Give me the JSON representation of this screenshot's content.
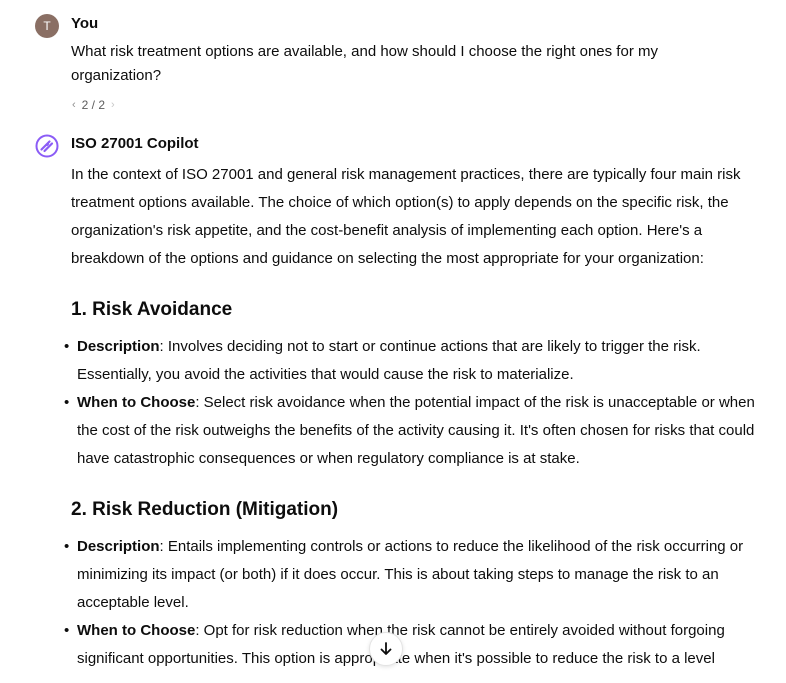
{
  "user_message": {
    "avatar_letter": "T",
    "author": "You",
    "text": "What risk treatment options are available, and how should I choose the right ones for my organization?",
    "pager": {
      "prev_icon": "chevron-left-icon",
      "label": "2 / 2",
      "next_icon": "chevron-right-icon"
    }
  },
  "assistant_message": {
    "author": "ISO 27001 Copilot",
    "avatar_icon": "copilot-logo-icon",
    "avatar_color": "#8b5cf6",
    "intro": "In the context of ISO 27001 and general risk management practices, there are typically four main risk treatment options available. The choice of which option(s) to apply depends on the specific risk, the organization's risk appetite, and the cost-benefit analysis of implementing each option. Here's a breakdown of the options and guidance on selecting the most appropriate for your organization:",
    "sections": [
      {
        "heading": "1. Risk Avoidance",
        "items": [
          {
            "label": "Description",
            "text": ": Involves deciding not to start or continue actions that are likely to trigger the risk. Essentially, you avoid the activities that would cause the risk to materialize."
          },
          {
            "label": "When to Choose",
            "text": ": Select risk avoidance when the potential impact of the risk is unacceptable or when the cost of the risk outweighs the benefits of the activity causing it. It's often chosen for risks that could have catastrophic consequences or when regulatory compliance is at stake."
          }
        ]
      },
      {
        "heading": "2. Risk Reduction (Mitigation)",
        "items": [
          {
            "label": "Description",
            "text": ": Entails implementing controls or actions to reduce the likelihood of the risk occurring or minimizing its impact (or both) if it does occur. This is about taking steps to manage the risk to an acceptable level."
          },
          {
            "label": "When to Choose",
            "text": ": Opt for risk reduction when the risk cannot be entirely avoided without forgoing significant opportunities. This option is appropriate when it's possible to reduce the risk to a level"
          }
        ]
      }
    ]
  },
  "scroll_button": {
    "icon": "arrow-down-icon"
  }
}
